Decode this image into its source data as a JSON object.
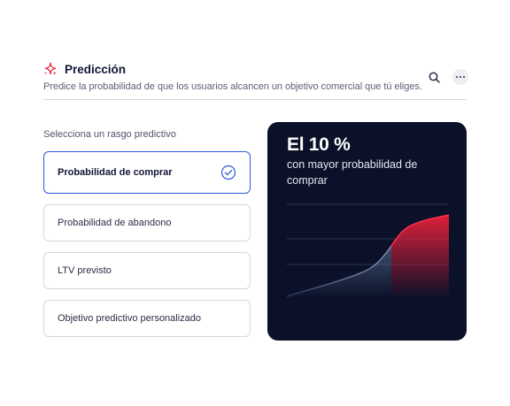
{
  "header": {
    "title": "Predicción",
    "subtitle": "Predice la probabilidad de que los usuarios alcancen un objetivo comercial que tú eliges.",
    "icons": {
      "title": "sparkle-icon",
      "search": "search-icon",
      "more": "more-horizontal-icon"
    }
  },
  "form": {
    "section_label": "Selecciona un rasgo predictivo",
    "options": [
      {
        "label": "Probabilidad de comprar",
        "selected": true
      },
      {
        "label": "Probabilidad de abandono",
        "selected": false
      },
      {
        "label": "LTV previsto",
        "selected": false
      },
      {
        "label": "Objetivo predictivo personalizado",
        "selected": false
      }
    ]
  },
  "card": {
    "stat": "El 10 %",
    "caption": "con mayor probabilidad de comprar"
  },
  "colors": {
    "accent": "#2e5ad6",
    "brand_red": "#e8203a",
    "card_bg": "#0a1128"
  }
}
